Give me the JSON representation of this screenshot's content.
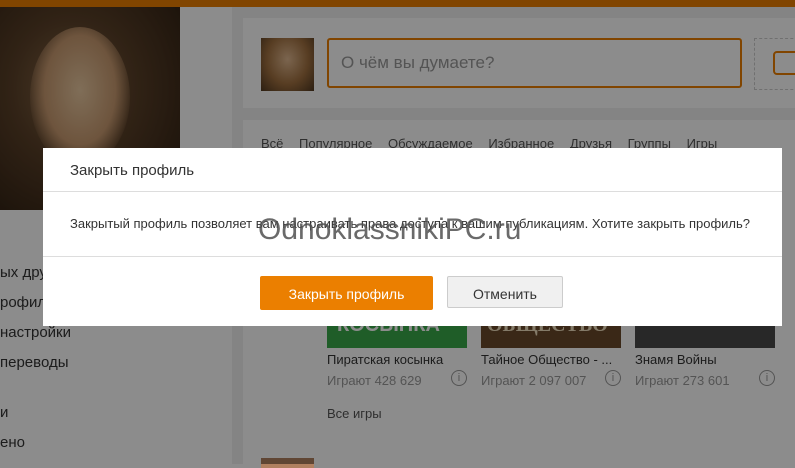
{
  "post": {
    "placeholder": "О чём вы думаете?"
  },
  "left_menu": {
    "items": [
      "ых дру",
      "рофил",
      "настройки",
      "переводы",
      "и",
      "ено"
    ]
  },
  "feed": {
    "tabs": [
      "Всё",
      "Популярное",
      "Обсуждаемое",
      "Избранное",
      "Друзья",
      "Группы",
      "Игры"
    ],
    "games": [
      {
        "title": "Пиратская косынка",
        "players": "Играют 428 629",
        "thumb_text": "КОСЫНКА",
        "thumb_color": "#3aaa4a"
      },
      {
        "title": "Тайное Общество - ...",
        "players": "Играют 2 097 007",
        "thumb_text": "ОБЩЕСТВО",
        "thumb_color": "#6a4a2a"
      },
      {
        "title": "Знамя Войны",
        "players": "Играют 273 601",
        "thumb_text": "",
        "thumb_color": "#4a4a4a"
      }
    ],
    "all_games": "Все игры"
  },
  "modal": {
    "title": "Закрыть профиль",
    "message": "Закрытый профиль позволяет вам настраивать права доступа к вашим публикациям. Хотите закрыть профиль?",
    "confirm_label": "Закрыть профиль",
    "cancel_label": "Отменить"
  },
  "watermark": "OdnoklassnikiPC.ru",
  "colors": {
    "accent": "#eb7f00"
  }
}
